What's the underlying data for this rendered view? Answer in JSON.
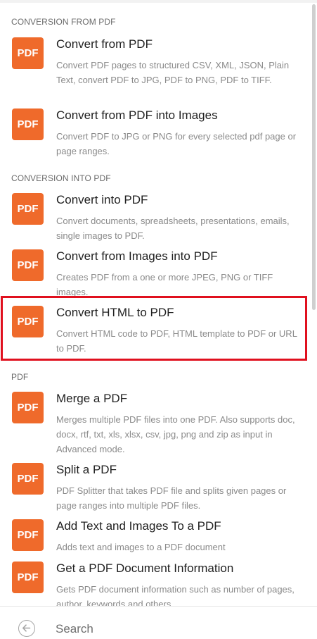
{
  "sections": [
    {
      "label": "CONVERSION FROM PDF"
    },
    {
      "label": "CONVERSION INTO PDF"
    },
    {
      "label": "PDF"
    }
  ],
  "icon_label": "PDF",
  "items": [
    {
      "title": "Convert from PDF",
      "description": "Convert PDF pages to structured CSV, XML, JSON, Plain Text, convert PDF to JPG, PDF to PNG, PDF to TIFF.",
      "icon": "pdf-icon"
    },
    {
      "title": "Convert from PDF into Images",
      "description": "Convert PDF to JPG or PNG for every selected pdf page or page ranges.",
      "icon": "pdf-icon"
    },
    {
      "title": "Convert into PDF",
      "description": "Convert documents, spreadsheets, presentations, emails, single images to PDF.",
      "icon": "pdf-icon"
    },
    {
      "title": "Convert from Images into PDF",
      "description": "Creates PDF from a one or more JPEG, PNG or TIFF images.",
      "icon": "pdf-icon"
    },
    {
      "title": "Convert HTML to PDF",
      "description": "Convert HTML code to PDF, HTML template to PDF or URL to PDF.",
      "icon": "pdf-icon",
      "highlighted": true
    },
    {
      "title": "Merge a PDF",
      "description": "Merges multiple PDF files into one PDF. Also supports doc, docx, rtf, txt, xls, xlsx, csv, jpg, png and zip as input in Advanced mode.",
      "icon": "pdf-icon"
    },
    {
      "title": "Split a PDF",
      "description": "PDF Splitter that takes PDF file and splits given pages or page ranges into multiple PDF files.",
      "icon": "pdf-icon"
    },
    {
      "title": "Add Text and Images To a PDF",
      "description": "Adds text and images to a PDF document",
      "icon": "pdf-icon"
    },
    {
      "title": "Get a PDF Document Information",
      "description": "Gets PDF document information such as number of pages, author, keywords and others.",
      "icon": "pdf-icon"
    }
  ],
  "footer": {
    "back_icon": "back-arrow-icon",
    "search_placeholder": "Search"
  },
  "colors": {
    "icon_bg": "#ef6a2b",
    "highlight_border": "#e0101e"
  }
}
